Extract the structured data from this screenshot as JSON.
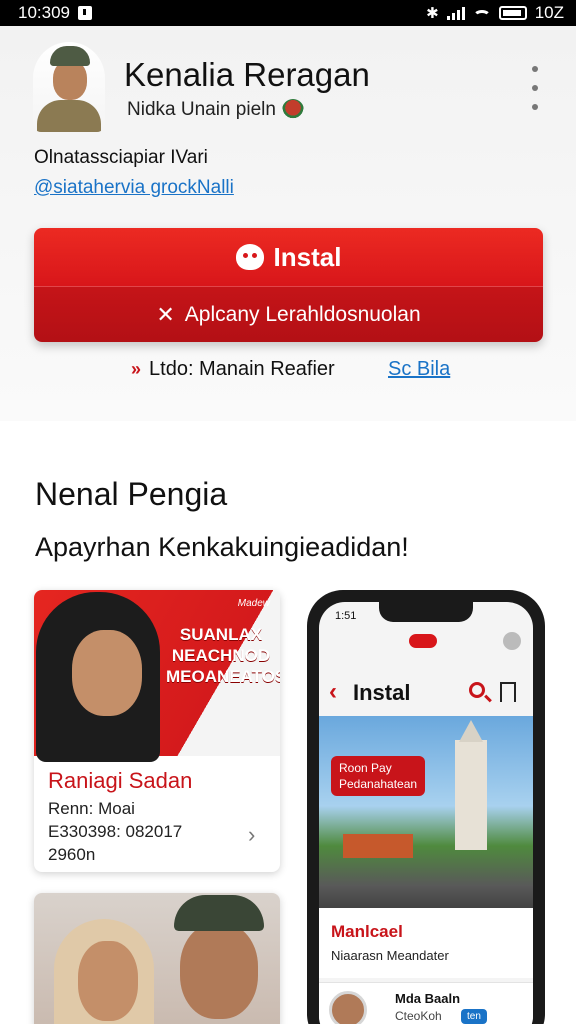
{
  "status_bar": {
    "time": "10:309",
    "battery_text": "10Z"
  },
  "profile": {
    "name": "Kenalia Reragan",
    "subtitle": "Nidka Unain pieln"
  },
  "info": {
    "label": "Olnatassciapiar IVari",
    "link": "@siatahervia grockNalli"
  },
  "actions": {
    "install_label": "Instal",
    "secondary_label": "Aplcany Lerahldosnuolan"
  },
  "meta": {
    "text": "Ltdo: Manain Reafier",
    "link": "Sc Bila"
  },
  "section": {
    "title": "Nenal Pengia",
    "subtitle": "Apayrhan Kenkakuingieadidan!"
  },
  "card1": {
    "brand": "Madew",
    "banner_lines": [
      "SUANLAX",
      "NEACHNOD",
      "MEOANEATOS"
    ],
    "title": "Raniagi Sadan",
    "line1": "Renn: Moai",
    "line2": "E330398: 082017",
    "line3": "2960n"
  },
  "phone": {
    "time": "1:51",
    "title": "Instal",
    "tag_line1": "Roon Pay",
    "tag_line2": "Pedanahatean",
    "card_title": "Manlcael",
    "card_sub": "Niaarasn Meandater",
    "row_name": "Mda Baaln",
    "row_sub": "CteoKoh",
    "row_badge": "ten"
  },
  "colors": {
    "accent_red": "#d8161a",
    "link_blue": "#1a73c7"
  }
}
